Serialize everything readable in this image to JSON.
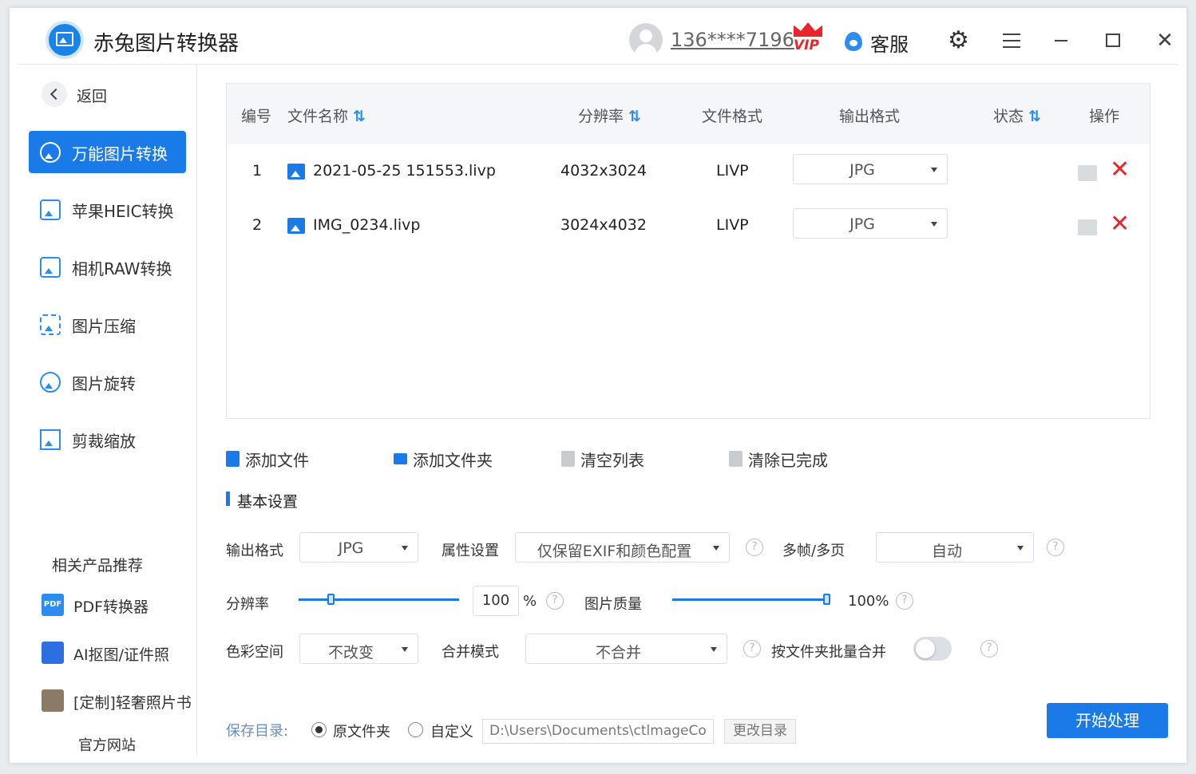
{
  "header": {
    "app_title": "赤兔图片转换器",
    "user_phone": "136****7196",
    "vip_badge": "VIP",
    "service_label": "客服"
  },
  "sidebar": {
    "back_label": "返回",
    "items": [
      {
        "label": "万能图片转换",
        "icon": "image-convert-icon",
        "active": true
      },
      {
        "label": "苹果HEIC转换",
        "icon": "heic-icon",
        "active": false
      },
      {
        "label": "相机RAW转换",
        "icon": "raw-icon",
        "active": false
      },
      {
        "label": "图片压缩",
        "icon": "compress-icon",
        "active": false
      },
      {
        "label": "图片旋转",
        "icon": "rotate-icon",
        "active": false
      },
      {
        "label": "剪裁缩放",
        "icon": "crop-icon",
        "active": false
      }
    ],
    "recommend_title": "相关产品推荐",
    "recommend": [
      {
        "label": "PDF转换器",
        "icon_text": "PDF"
      },
      {
        "label": "AI抠图/证件照",
        "icon_text": ""
      },
      {
        "label": "[定制]轻奢照片书",
        "icon_text": ""
      }
    ],
    "official_site": "官方网站"
  },
  "table": {
    "headers": {
      "index": "编号",
      "name": "文件名称",
      "resolution": "分辨率",
      "format": "文件格式",
      "output": "输出格式",
      "status": "状态",
      "action": "操作"
    },
    "sort_glyph": "⇅",
    "rows": [
      {
        "index": "1",
        "name": "2021-05-25 151553.livp",
        "resolution": "4032x3024",
        "format": "LIVP",
        "output": "JPG",
        "status": ""
      },
      {
        "index": "2",
        "name": "IMG_0234.livp",
        "resolution": "3024x4032",
        "format": "LIVP",
        "output": "JPG",
        "status": ""
      }
    ]
  },
  "actions": {
    "add_file": "添加文件",
    "add_folder": "添加文件夹",
    "clear_list": "清空列表",
    "clear_done": "清除已完成"
  },
  "settings": {
    "section_title": "基本设置",
    "output_format_label": "输出格式",
    "output_format_value": "JPG",
    "attr_label": "属性设置",
    "attr_value": "仅保留EXIF和颜色配置",
    "multiframe_label": "多帧/多页",
    "multiframe_value": "自动",
    "resolution_label": "分辨率",
    "resolution_value": "100",
    "resolution_unit": "%",
    "resolution_fraction": 0.2,
    "quality_label": "图片质量",
    "quality_value": "100%",
    "quality_fraction": 1.0,
    "colorspace_label": "色彩空间",
    "colorspace_value": "不改变",
    "merge_label": "合并模式",
    "merge_value": "不合并",
    "batch_merge_label": "按文件夹批量合并",
    "batch_merge_on": false
  },
  "footer": {
    "save_dir_label": "保存目录:",
    "option_original": "原文件夹",
    "option_custom": "自定义",
    "path": "D:\\Users\\Documents\\ctlmageCo",
    "change_dir": "更改目录",
    "start": "开始处理"
  },
  "colors": {
    "accent": "#1a7be8",
    "danger": "#e8262b"
  }
}
